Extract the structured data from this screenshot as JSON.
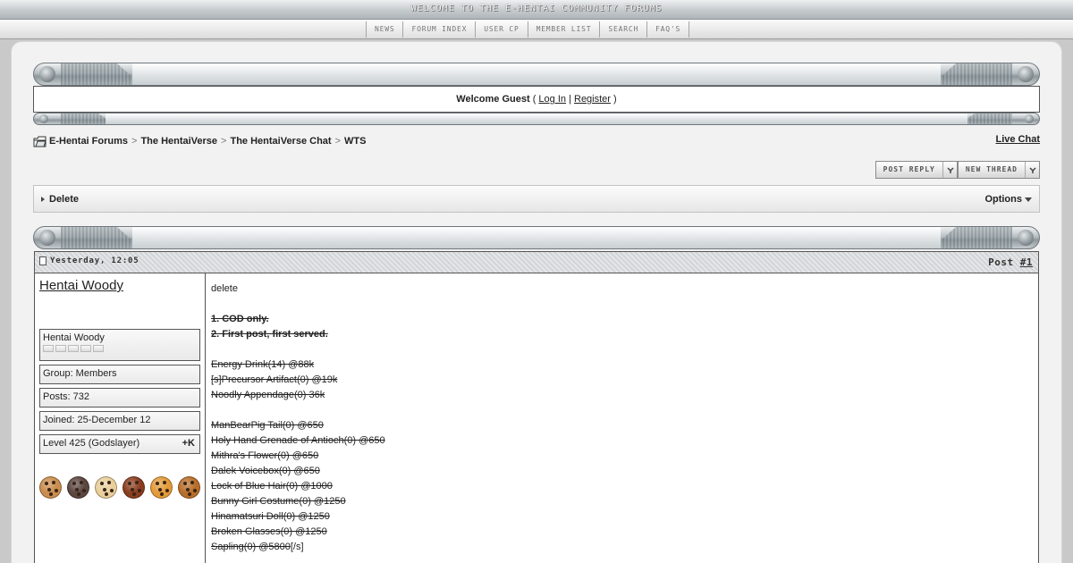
{
  "banner": {
    "welcome": "WELCOME TO THE E-HENTAI COMMUNITY FORUMS"
  },
  "nav": {
    "items": [
      "NEWS",
      "FORUM INDEX",
      "USER CP",
      "MEMBER LIST",
      "SEARCH",
      "FAQ'S"
    ]
  },
  "welcome_box": {
    "prefix": "Welcome Guest",
    "open_paren": "(",
    "login": "Log In",
    "separator": "|",
    "register": "Register",
    "close_paren": ")"
  },
  "breadcrumb": {
    "items": [
      "E-Hentai Forums",
      "The HentaiVerse",
      "The HentaiVerse Chat",
      "WTS"
    ],
    "separator": ">"
  },
  "live_chat": "Live Chat",
  "buttons": {
    "post_reply": "POST REPLY",
    "new_thread": "NEW THREAD"
  },
  "mod_bar": {
    "delete": "Delete",
    "options": "Options"
  },
  "post": {
    "date": "Yesterday, 12:05",
    "number_prefix": "Post",
    "number": "#1",
    "user": {
      "name": "Hentai Woody",
      "title": "Hentai Woody",
      "stars": 5,
      "group": "Group: Members",
      "posts": "Posts: 732",
      "joined": "Joined: 25-December 12",
      "level": "Level 425 (Godslayer)",
      "karma": "+K"
    },
    "cookie_colors": [
      "#c98d4d",
      "#5b4640",
      "#e8cf9b",
      "#8a3d1f",
      "#e39a3a",
      "#b86e2a"
    ],
    "body": [
      {
        "text": "delete",
        "style": "plain"
      },
      {
        "text": "",
        "style": "plain"
      },
      {
        "text": "1. COD only.",
        "style": "bold-strike"
      },
      {
        "text": "2. First post, first served.",
        "style": "bold-strike"
      },
      {
        "text": "",
        "style": "plain"
      },
      {
        "text": "Energy Drink(14) @88k",
        "style": "strike"
      },
      {
        "text": "[s]Precursor Artifact(0) @19k",
        "style": "strike"
      },
      {
        "text": "Noodly Appendage(0) 36k",
        "style": "strike"
      },
      {
        "text": "",
        "style": "plain"
      },
      {
        "text": "ManBearPig Tail(0) @650",
        "style": "strike"
      },
      {
        "text": "Holy Hand Grenade of Antioch(0) @650",
        "style": "strike"
      },
      {
        "text": "Mithra's Flower(0) @650",
        "style": "strike"
      },
      {
        "text": "Dalek Voicebox(0) @650",
        "style": "strike"
      },
      {
        "text": "Lock of Blue Hair(0) @1000",
        "style": "strike"
      },
      {
        "text": "Bunny Girl Costume(0) @1250",
        "style": "strike"
      },
      {
        "text": "Hinamatsuri Doll(0) @1250",
        "style": "strike"
      },
      {
        "text": "Broken Glasses(0) @1250",
        "style": "strike"
      },
      {
        "text": "Sapling(0) @5800",
        "style": "strike",
        "suffix": "[/s]"
      }
    ]
  }
}
